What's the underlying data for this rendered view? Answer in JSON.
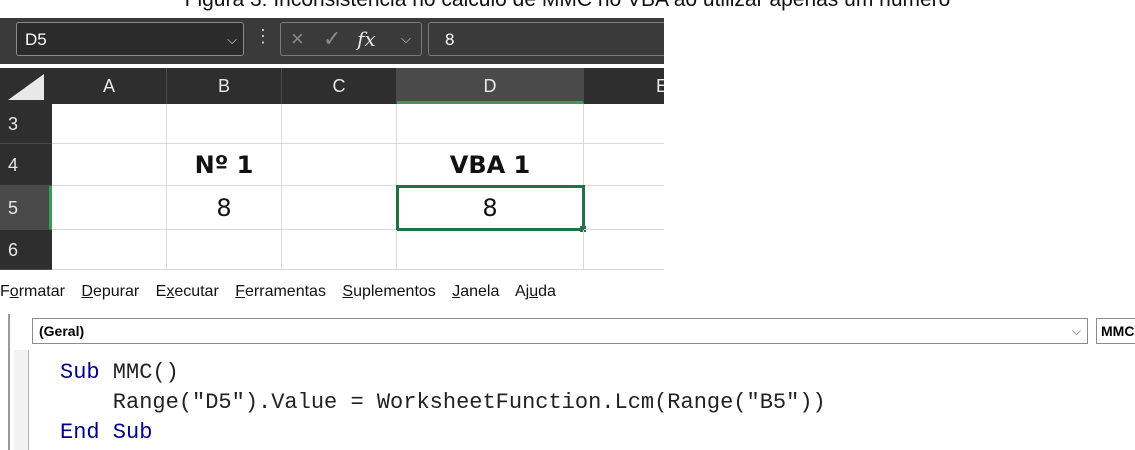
{
  "caption": "Figura 3: Inconsistência no cálculo de MMC no VBA ao utilizar apenas um número",
  "formula_bar": {
    "name_box": "D5",
    "cancel_icon": "×",
    "enter_icon": "✓",
    "fx_label": "fx",
    "value": "8"
  },
  "columns": [
    "A",
    "B",
    "C",
    "D",
    "E"
  ],
  "rows": [
    "3",
    "4",
    "5",
    "6"
  ],
  "cells": {
    "B4": "Nº 1",
    "D4": "VBA 1",
    "B5": "8",
    "D5": "8"
  },
  "vba": {
    "menu": [
      "Formatar",
      "Depurar",
      "Executar",
      "Ferramentas",
      "Suplementos",
      "Janela",
      "Ajuda"
    ],
    "object_combo": "(Geral)",
    "proc_combo": "MMC",
    "code": {
      "line1_kw": "Sub",
      "line1_rest": " MMC()",
      "line2": "    Range(\"D5\").Value = WorksheetFunction.Lcm(Range(\"B5\"))",
      "line3": "End Sub"
    }
  },
  "colors": {
    "selection_green": "#217346",
    "header_dark": "#2e2e2e",
    "vba_keyword": "#00008b"
  }
}
